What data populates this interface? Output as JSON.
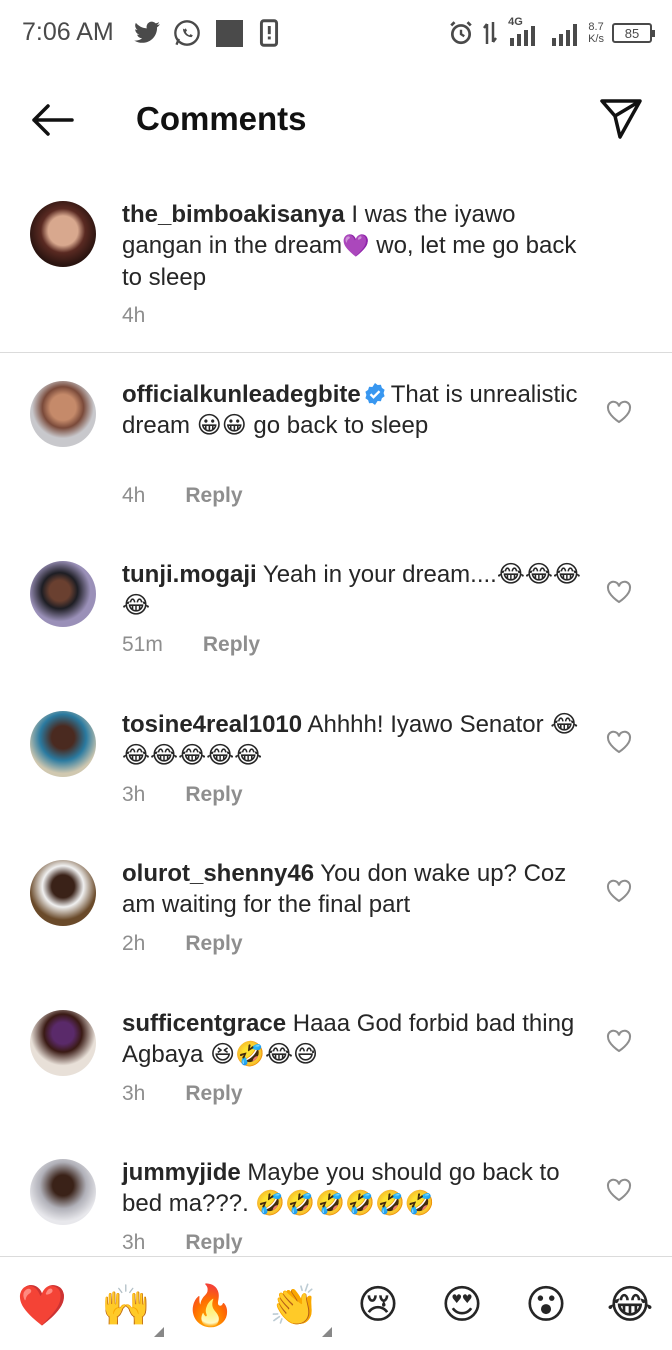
{
  "status": {
    "time": "7:06 AM",
    "network": "4G",
    "speed_value": "8.7",
    "speed_unit": "K/s",
    "battery": "85",
    "icons": [
      "twitter-icon",
      "whatsapp-icon",
      "square-icon",
      "phone-alert-icon",
      "alarm-icon",
      "signal-icon"
    ]
  },
  "header": {
    "title": "Comments",
    "icons": [
      "back-arrow-icon",
      "send-icon"
    ]
  },
  "caption": {
    "username": "the_bimboakisanya",
    "text_before_emoji": " I was the iyawo gangan in the dream",
    "emoji": "💜",
    "text_after_emoji": " wo, let me go back to sleep",
    "time": "4h"
  },
  "comments": [
    {
      "username": "officialkunleadegbite",
      "verified": true,
      "text": "That is unrealistic dream 😀😀 go back to sleep",
      "time": "4h",
      "reply_label": "Reply"
    },
    {
      "username": "tunji.mogaji",
      "verified": false,
      "text": "Yeah in your dream....😂😂😂😂",
      "time": "51m",
      "reply_label": "Reply"
    },
    {
      "username": "tosine4real1010",
      "verified": false,
      "text": "Ahhhh! Iyawo Senator 😂😂😂😂😂😂",
      "time": "3h",
      "reply_label": "Reply"
    },
    {
      "username": "olurot_shenny46",
      "verified": false,
      "text": "You don wake up? Coz am waiting for the final part",
      "time": "2h",
      "reply_label": "Reply"
    },
    {
      "username": "sufficentgrace",
      "verified": false,
      "text": "Haaa God forbid bad thing Agbaya 😆🤣😂😅",
      "time": "3h",
      "reply_label": "Reply"
    },
    {
      "username": "jummyjide",
      "verified": false,
      "text": "Maybe you should go back to bed ma???. 🤣🤣🤣🤣🤣🤣",
      "time": "3h",
      "reply_label": "Reply"
    }
  ],
  "reactions": [
    "❤️",
    "🙌",
    "🔥",
    "👏",
    "😢",
    "😍",
    "😮",
    "😂"
  ],
  "colors": {
    "text": "#262626",
    "meta": "#8e8e8e",
    "verified": "#3897f0",
    "divider": "#dbdbdb"
  }
}
